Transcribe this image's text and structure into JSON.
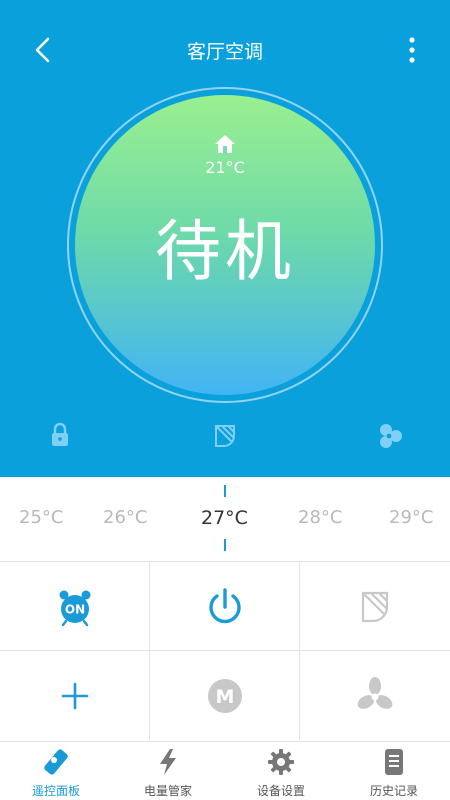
{
  "header": {
    "title": "客厅空调"
  },
  "status": {
    "indoor_temp": "21°C",
    "state": "待机"
  },
  "feature_icons": [
    "lock-icon",
    "swing-icon",
    "fan-speed-icon"
  ],
  "temperatures": [
    "25°C",
    "26°C",
    "27°C",
    "28°C",
    "29°C"
  ],
  "selected_temp": "27°C",
  "controls": {
    "timer_badge": "ON",
    "mode_badge": "M"
  },
  "tabs": [
    {
      "label": "遥控面板"
    },
    {
      "label": "电量管家"
    },
    {
      "label": "设备设置"
    },
    {
      "label": "历史记录"
    }
  ],
  "colors": {
    "primary": "#0aa0dc",
    "accent": "#1a9bd8",
    "disabled": "#c8c8c8"
  }
}
